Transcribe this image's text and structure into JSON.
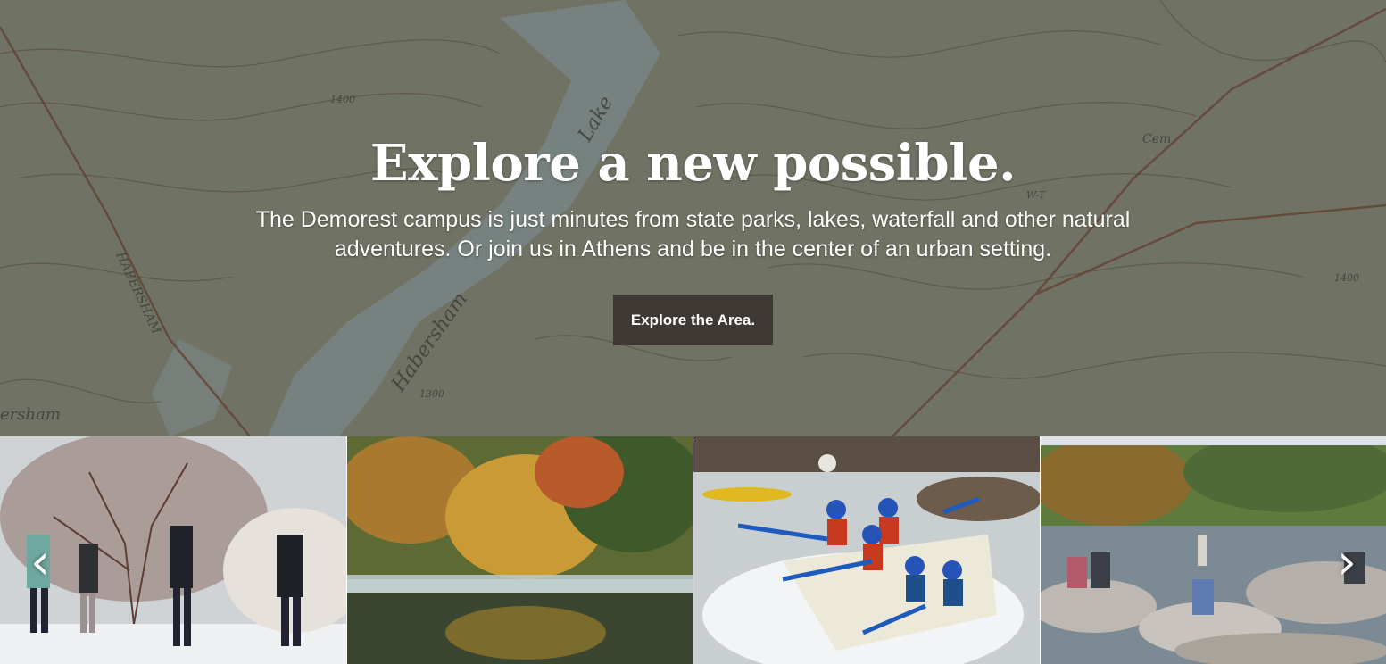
{
  "hero": {
    "title": "Explore a new possible.",
    "description": "The Demorest campus is just minutes from state parks, lakes, waterfall and other natural adventures. Or join us in Athens and be in the center of an urban setting.",
    "cta_label": "Explore the Area.",
    "map_labels": [
      "Lake",
      "Habersham",
      "HABERSHAM",
      "ersham",
      "Cem",
      "1400",
      "1400",
      "1300",
      "W-T"
    ],
    "colors": {
      "overlay": "#46423c",
      "button": "#3e3935",
      "map_green": "#8c9a7c",
      "contour": "#6b5a3e",
      "water": "#9fb9c4"
    }
  },
  "gallery": {
    "images": [
      {
        "name": "snowy-campus-walk",
        "alt": "Students walking on a snowy campus path"
      },
      {
        "name": "autumn-lake-forest",
        "alt": "Misty lake with autumn trees"
      },
      {
        "name": "whitewater-rafting",
        "alt": "Group whitewater rafting"
      },
      {
        "name": "river-rocks-hangout",
        "alt": "Students sitting on river rocks"
      }
    ],
    "prev_icon": "chevron-left-icon",
    "next_icon": "chevron-right-icon",
    "prev_glyph": "‹",
    "next_glyph": "›"
  }
}
